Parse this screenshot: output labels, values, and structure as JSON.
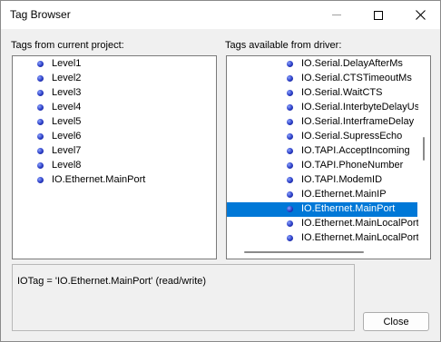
{
  "window": {
    "title": "Tag Browser"
  },
  "left_panel": {
    "label": "Tags from current project:",
    "items": [
      "Level1",
      "Level2",
      "Level3",
      "Level4",
      "Level5",
      "Level6",
      "Level7",
      "Level8",
      "IO.Ethernet.MainPort"
    ]
  },
  "right_panel": {
    "label": "Tags available from driver:",
    "items": [
      "IO.Serial.DelayAfterMs",
      "IO.Serial.CTSTimeoutMs",
      "IO.Serial.WaitCTS",
      "IO.Serial.InterbyteDelayUs",
      "IO.Serial.InterframeDelay",
      "IO.Serial.SupressEcho",
      "IO.TAPI.AcceptIncoming",
      "IO.TAPI.PhoneNumber",
      "IO.TAPI.ModemID",
      "IO.Ethernet.MainIP",
      "IO.Ethernet.MainPort",
      "IO.Ethernet.MainLocalPort",
      "IO.Ethernet.MainLocalPort"
    ],
    "selected_index": 10
  },
  "info": {
    "text": "IOTag = 'IO.Ethernet.MainPort' (read/write)"
  },
  "buttons": {
    "close_label": "Close"
  },
  "colors": {
    "selection": "#0078d7",
    "bullet": "#2a3cc4"
  }
}
